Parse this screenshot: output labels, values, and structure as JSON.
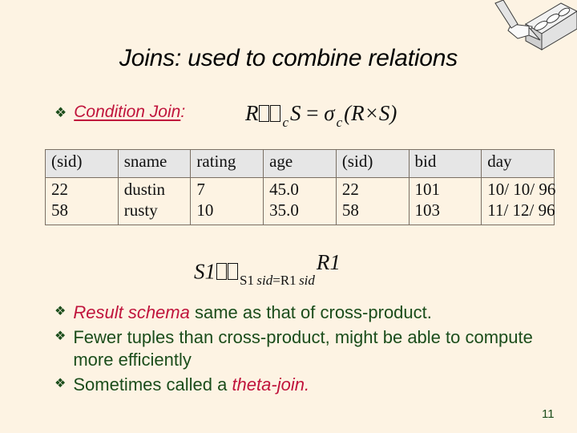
{
  "slide": {
    "title": "Joins: used to combine relations",
    "page_number": "11",
    "background_color": "#fdf3e3",
    "accent_color": "#c0143c",
    "body_color": "#1b4d1b"
  },
  "bullet_glyph": "❖",
  "condition_join": {
    "label": "Condition Join",
    "colon": ":",
    "formula": {
      "left_relation": "R",
      "join_symbol": "tofu-box-glyph",
      "subscript": "c",
      "right_relation": "S",
      "equals": "=",
      "sigma": "σ",
      "sigma_subscript": "c",
      "expression": "(R×S)"
    }
  },
  "result_table": {
    "headers": [
      "(sid)",
      "sname",
      "rating",
      "age",
      "(sid)",
      "bid",
      "day"
    ],
    "rows": [
      [
        "22",
        "dustin",
        "7",
        "45.0",
        "22",
        "101",
        "10/ 10/ 96"
      ],
      [
        "58",
        "rusty",
        "10",
        "35.0",
        "58",
        "103",
        "11/ 12/ 96"
      ]
    ]
  },
  "join_expression": {
    "left": "S1",
    "join_symbol": "tofu-box-glyph",
    "condition": "S1.sid = R1.sid",
    "condition_parts": {
      "left_attr": "S1",
      "left_dot_attr": "sid",
      "equals": "=",
      "right_attr": "R1",
      "right_dot_attr": "sid"
    },
    "right": "R1"
  },
  "bullets": [
    {
      "emphasis": "Result schema",
      "text": " same as that of cross-product."
    },
    {
      "emphasis": "",
      "text": "Fewer tuples than cross-product, might be able to compute more efficiently"
    },
    {
      "prefix": "Sometimes called a ",
      "emphasis_trailing": "theta-join."
    }
  ],
  "clipart": {
    "name": "brick-and-trowel-clipart",
    "description": "grayscale brick with three oval holes and a trowel"
  }
}
